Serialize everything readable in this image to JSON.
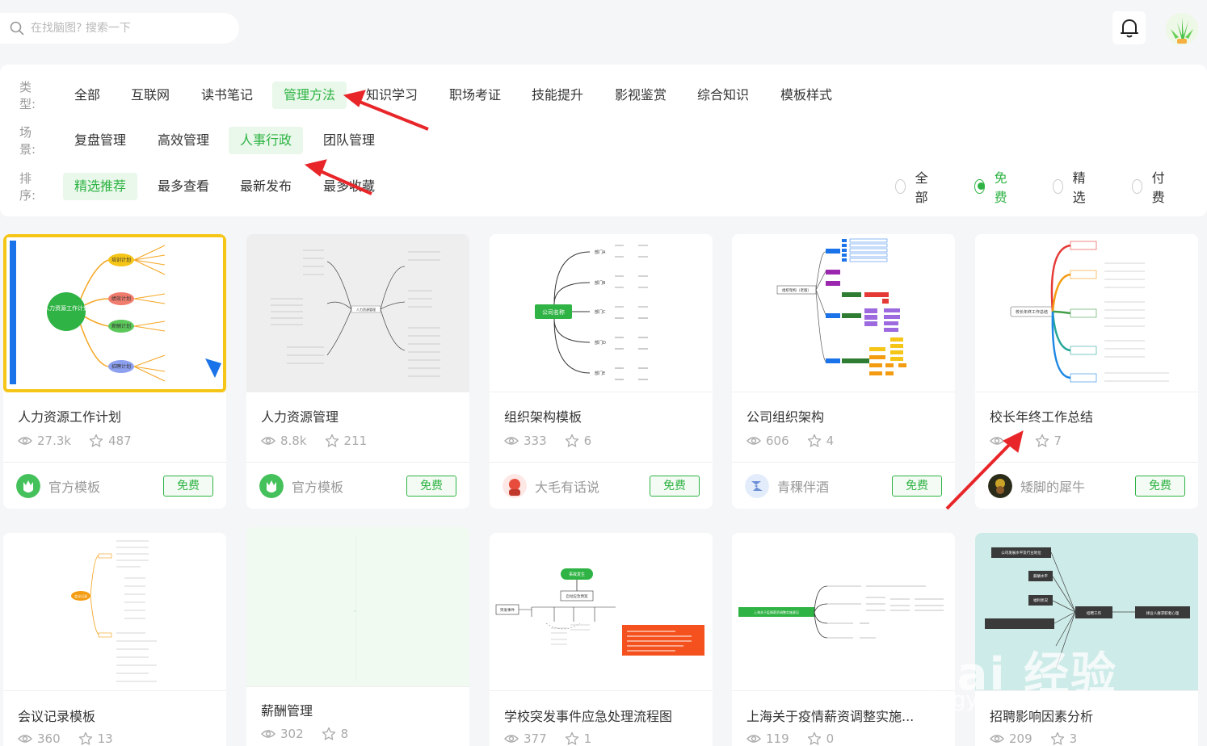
{
  "search": {
    "placeholder": "在找脑图? 搜索一下"
  },
  "filters": {
    "type_label": "类型:",
    "types": [
      "全部",
      "互联网",
      "读书笔记",
      "管理方法",
      "知识学习",
      "职场考证",
      "技能提升",
      "影视鉴赏",
      "综合知识",
      "模板样式"
    ],
    "type_active": "管理方法",
    "scene_label": "场景:",
    "scenes": [
      "复盘管理",
      "高效管理",
      "人事行政",
      "团队管理"
    ],
    "scene_active": "人事行政",
    "sort_label": "排序:",
    "sorts": [
      "精选推荐",
      "最多查看",
      "最新发布",
      "最多收藏"
    ],
    "sort_active": "精选推荐",
    "prices": [
      "全部",
      "免费",
      "精选",
      "付费"
    ],
    "price_active": "免费"
  },
  "cards": [
    {
      "title": "人力资源工作计划",
      "views": "27.3k",
      "stars": "487",
      "author": "官方模板",
      "badge": "免费",
      "thumb_texts": [
        "人力资源工作计划",
        "培训计划",
        "绩效计划",
        "薪酬计划",
        "招聘计划"
      ]
    },
    {
      "title": "人力资源管理",
      "views": "8.8k",
      "stars": "211",
      "author": "官方模板",
      "badge": "免费",
      "thumb_texts": [
        "人力资源管理"
      ]
    },
    {
      "title": "组织架构模板",
      "views": "333",
      "stars": "6",
      "author": "大毛有话说",
      "badge": "免费",
      "thumb_texts": [
        "公司名称",
        "部门A",
        "部门B",
        "部门C",
        "部门D",
        "部门E"
      ]
    },
    {
      "title": "公司组织架构",
      "views": "606",
      "stars": "4",
      "author": "青稞伴酒",
      "badge": "免费",
      "thumb_texts": [
        "组织架构（老版）"
      ]
    },
    {
      "title": "校长年终工作总结",
      "views": "0",
      "stars": "7",
      "author": "矮脚的犀牛",
      "badge": "免费",
      "thumb_texts": [
        "校长年终工作总结"
      ]
    },
    {
      "title": "会议记录模板",
      "views": "360",
      "stars": "13",
      "thumb_texts": [
        "会议记录"
      ]
    },
    {
      "title": "薪酬管理",
      "views": "302",
      "stars": "8",
      "thumb_texts": []
    },
    {
      "title": "学校突发事件应急处理流程图",
      "views": "377",
      "stars": "1",
      "thumb_texts": [
        "突发事件",
        "事故发生",
        "启动应急预案"
      ]
    },
    {
      "title": "上海关于疫情薪资调整实施...",
      "views": "119",
      "stars": "0",
      "thumb_texts": [
        "上海关于疫情薪资调整实施意见"
      ]
    },
    {
      "title": "招聘影响因素分析",
      "views": "209",
      "stars": "3",
      "thumb_texts": [
        "公司发展水平及行业地位",
        "薪酬水平",
        "福利状况",
        "招聘工作",
        "择业人群求职者心理"
      ]
    }
  ],
  "watermark": {
    "main": "Bai 经验",
    "sub": "jingyan.baidu.com"
  },
  "colors": {
    "accent": "#2fb344",
    "arrow": "#e8262a"
  }
}
